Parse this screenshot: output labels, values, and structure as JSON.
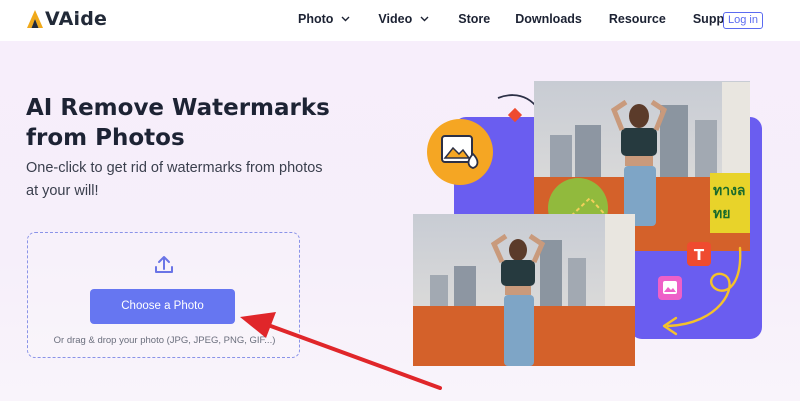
{
  "brand": {
    "name": "AVAide",
    "logo_text": "VAide",
    "accent": "#5b6bf0",
    "logo_color": "#f0a91a"
  },
  "nav": {
    "items": [
      {
        "label": "Photo",
        "has_dropdown": true
      },
      {
        "label": "Video",
        "has_dropdown": true
      },
      {
        "label": "Store",
        "has_dropdown": false
      },
      {
        "label": "Downloads",
        "has_dropdown": false
      },
      {
        "label": "Resource",
        "has_dropdown": false
      },
      {
        "label": "Support",
        "has_dropdown": false
      }
    ],
    "login_label": "Log in"
  },
  "hero": {
    "title": "AI Remove Watermarks from Photos",
    "subtitle": "One-click to get rid of watermarks from photos at your will!",
    "upload": {
      "icon": "upload-icon",
      "button_label": "Choose a Photo",
      "hint": "Or drag & drop your photo (JPG, JPEG, PNG, GIF...)"
    }
  },
  "illustration": {
    "badge_text_icon": "T",
    "icons": [
      "image-drop-icon",
      "text-icon",
      "image-icon",
      "curly-arrow-icon"
    ],
    "colors": {
      "purple": "#6a5df0",
      "orange": "#f5a623",
      "red": "#ef4b2f",
      "wall": "#d4612a"
    }
  },
  "annotation": {
    "icon": "red-arrow-icon",
    "color": "#e0262a"
  }
}
